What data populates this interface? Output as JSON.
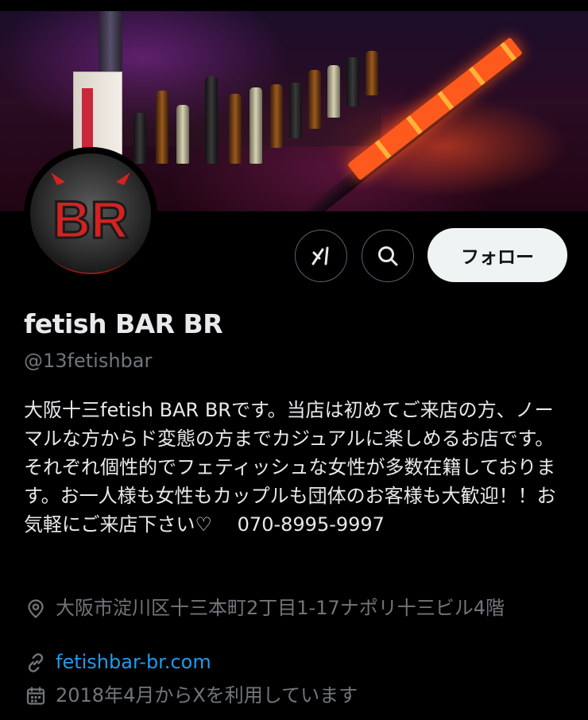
{
  "profile": {
    "display_name": "fetish BAR BR",
    "handle": "@13fetishbar",
    "bio": "大阪十三fetish BAR BRです。当店は初めてご来店の方、ノーマルな方からド変態の方までカジュアルに楽しめるお店です。それぞれ個性的でフェティッシュな女性が多数在籍しております。お一人様も女性もカップルも団体のお客様も大歓迎！！お気軽にご来店下さい♡　 070-8995-9997",
    "location": "大阪市淀川区十三本町2丁目1-17ナポリ十三ビル4階",
    "website": "fetishbar-br.com",
    "joined": "2018年4月からXを利用しています",
    "avatar_text": "BR"
  },
  "actions": {
    "follow_label": "フォロー",
    "grok_icon": "grok-icon",
    "search_icon": "search-icon"
  },
  "icons": {
    "location": "location-pin-icon",
    "link": "link-icon",
    "calendar": "calendar-icon"
  },
  "colors": {
    "background": "#000000",
    "text_primary": "#e7e9ea",
    "text_secondary": "#71767b",
    "link": "#1d9bf0",
    "follow_bg": "#eff3f4",
    "avatar_red": "#d42222"
  }
}
